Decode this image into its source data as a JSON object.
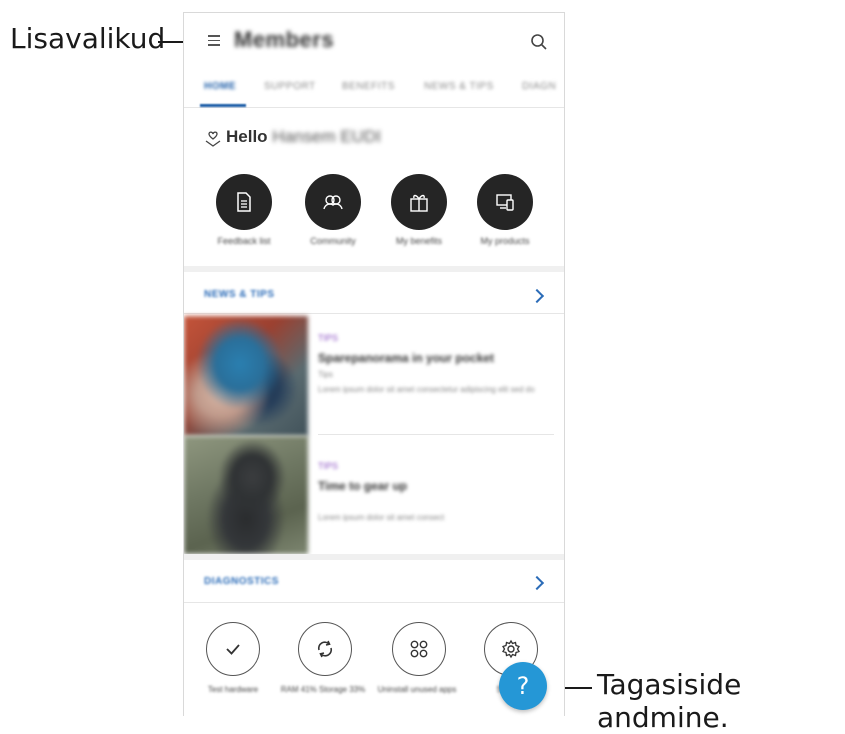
{
  "callouts": {
    "left": "Lisavalikud",
    "right": "Tagasiside andmine."
  },
  "header": {
    "title": "Members",
    "menu_icon": "menu-icon",
    "search_icon": "search-icon"
  },
  "tabs": [
    {
      "label": "HOME",
      "active": true
    },
    {
      "label": "SUPPORT"
    },
    {
      "label": "BENEFITS"
    },
    {
      "label": "NEWS & TIPS"
    },
    {
      "label": "DIAGN"
    }
  ],
  "greeting": {
    "prefix": "Hello",
    "name": "Hansem EUDI"
  },
  "quick_actions": [
    {
      "label": "Feedback list",
      "icon": "document-icon"
    },
    {
      "label": "Community",
      "icon": "community-icon"
    },
    {
      "label": "My benefits",
      "icon": "gift-icon"
    },
    {
      "label": "My products",
      "icon": "devices-icon"
    }
  ],
  "news": {
    "heading": "NEWS & TIPS",
    "items": [
      {
        "tag": "TIPS",
        "headline": "Sparepanorama in your pocket",
        "meta": "Tips",
        "desc": "Lorem ipsum dolor sit amet consectetur adipiscing elit sed do"
      },
      {
        "tag": "TIPS",
        "headline": "Time to gear up",
        "meta": "",
        "desc": "Lorem ipsum dolor sit amet consect"
      }
    ]
  },
  "diagnostics": {
    "heading": "DIAGNOSTICS",
    "items": [
      {
        "label": "Test hardware",
        "icon": "check-icon"
      },
      {
        "label": "RAM 41% Storage 33%",
        "icon": "refresh-icon"
      },
      {
        "label": "Uninstall unused apps",
        "icon": "apps-icon"
      },
      {
        "label": "Settings",
        "icon": "gear-icon"
      }
    ]
  },
  "fab": {
    "label": "?",
    "icon": "help-icon"
  },
  "colors": {
    "accent": "#2b6cb8",
    "fab": "#2597d6",
    "tag": "#8a4fc2"
  }
}
